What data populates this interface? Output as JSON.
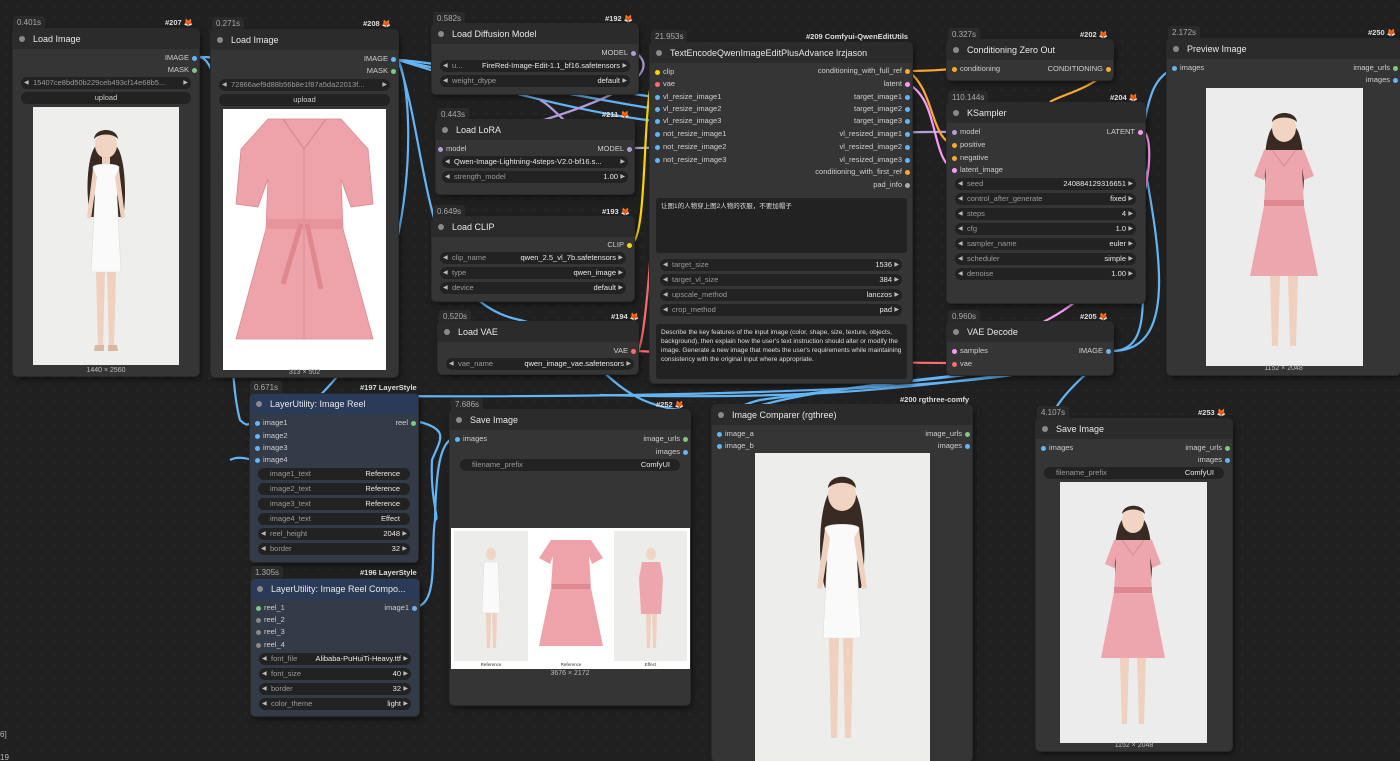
{
  "colors": {
    "image": "#64b5f6",
    "mask": "#81c784",
    "model": "#b39ddb",
    "clip": "#ffd500",
    "vae": "#ff6e6e",
    "conditioning": "#ffa931",
    "latent": "#ff9cf9",
    "string": "#7ecc7e"
  },
  "side_labels": [
    "6]",
    "19"
  ],
  "n207": {
    "time": "0.401s",
    "id": "#207",
    "title": "Load Image",
    "out1": "IMAGE",
    "out2": "MASK",
    "file": "15407ce8bd50b229ceb493cf14e68b5...",
    "upload": "upload",
    "cap": "1440 × 2560"
  },
  "n208": {
    "time": "0.271s",
    "id": "#208",
    "title": "Load Image",
    "out1": "IMAGE",
    "out2": "MASK",
    "file": "72866aef9d88b56b8e1f87a5da22013f...",
    "upload": "upload",
    "cap": "313 × 502"
  },
  "n192": {
    "time": "0.582s",
    "id": "#192",
    "title": "Load Diffusion Model",
    "out1": "MODEL",
    "w1_lbl": "u...",
    "w1_val": "FireRed-Image-Edit-1.1_bf16.safetensors",
    "w2_lbl": "weight_dtype",
    "w2_val": "default"
  },
  "n211": {
    "time": "0.443s",
    "id": "#211",
    "title": "Load LoRA",
    "in1": "model",
    "out1": "MODEL",
    "w1_val": "Qwen-Image-Lightning-4steps-V2.0-bf16.s...",
    "w2_lbl": "strength_model",
    "w2_val": "1.00"
  },
  "n193": {
    "time": "0.649s",
    "id": "#193",
    "title": "Load CLIP",
    "out1": "CLIP",
    "w1_lbl": "clip_name",
    "w1_val": "qwen_2.5_vl_7b.safetensors",
    "w2_lbl": "type",
    "w2_val": "qwen_image",
    "w3_lbl": "device",
    "w3_val": "default"
  },
  "n194": {
    "time": "0.520s",
    "id": "#194",
    "title": "Load VAE",
    "out1": "VAE",
    "w1_lbl": "vae_name",
    "w1_val": "qwen_image_vae.safetensors"
  },
  "n209": {
    "time": "21.953s",
    "id": "#209 Comfyui-QwenEditUtils",
    "title": "TextEncodeQwenImageEditPlusAdvance lrzjason",
    "inputs": [
      "clip",
      "vae",
      "vl_resize_image1",
      "vl_resize_image2",
      "vl_resize_image3",
      "not_resize_image1",
      "not_resize_image2",
      "not_resize_image3"
    ],
    "outputs": [
      "conditioning_with_full_ref",
      "latent",
      "target_image1",
      "target_image2",
      "target_image3",
      "vl_resized_image1",
      "vl_resized_image2",
      "vl_resized_image3",
      "conditioning_with_first_ref",
      "pad_info"
    ],
    "prompt": "让图1的人物穿上图2人物的衣服，不要加帽子",
    "w1_lbl": "target_size",
    "w1_val": "1536",
    "w2_lbl": "target_vl_size",
    "w2_val": "384",
    "w3_lbl": "upscale_method",
    "w3_val": "lanczos",
    "w4_lbl": "crop_method",
    "w4_val": "pad",
    "system": "Describe the key features of the input image (color, shape, size, texture, objects, background), then explain how the user's text instruction should alter or modify the image. Generate a new image that meets the user's requirements while maintaining consistency with the original input where appropriate."
  },
  "n202": {
    "time": "0.327s",
    "id": "#202",
    "title": "Conditioning Zero Out",
    "in1": "conditioning",
    "out1": "CONDITIONING"
  },
  "n204": {
    "time": "110.144s",
    "id": "#204",
    "title": "KSampler",
    "inputs": [
      "model",
      "positive",
      "negative",
      "latent_image"
    ],
    "out1": "LATENT",
    "widgets": [
      {
        "lbl": "seed",
        "val": "240884129316651"
      },
      {
        "lbl": "control_after_generate",
        "val": "fixed"
      },
      {
        "lbl": "steps",
        "val": "4"
      },
      {
        "lbl": "cfg",
        "val": "1.0"
      },
      {
        "lbl": "sampler_name",
        "val": "euler"
      },
      {
        "lbl": "scheduler",
        "val": "simple"
      },
      {
        "lbl": "denoise",
        "val": "1.00"
      }
    ]
  },
  "n205": {
    "time": "0.960s",
    "id": "#205",
    "title": "VAE Decode",
    "in1": "samples",
    "in2": "vae",
    "out1": "IMAGE"
  },
  "n250": {
    "time": "2.172s",
    "id": "#250",
    "title": "Preview Image",
    "in1": "images",
    "out1": "image_urls",
    "out2": "images",
    "cap": "1152 × 2048"
  },
  "n197": {
    "time": "0.671s",
    "id": "#197 LayerStyle",
    "title": "LayerUtility: Image Reel",
    "inputs": [
      "image1",
      "image2",
      "image3",
      "image4"
    ],
    "out1": "reel",
    "widgets": [
      {
        "lbl": "image1_text",
        "val": "Reference"
      },
      {
        "lbl": "image2_text",
        "val": "Reference"
      },
      {
        "lbl": "image3_text",
        "val": "Reference"
      },
      {
        "lbl": "image4_text",
        "val": "Effect"
      },
      {
        "lbl": "reel_height",
        "val": "2048"
      },
      {
        "lbl": "border",
        "val": "32"
      }
    ]
  },
  "n196": {
    "time": "1.305s",
    "id": "#196 LayerStyle",
    "title": "LayerUtility: Image Reel Compo...",
    "inputs": [
      "reel_1",
      "reel_2",
      "reel_3",
      "reel_4"
    ],
    "out1": "image1",
    "widgets": [
      {
        "lbl": "font_file",
        "val": "Alibaba-PuHuiTi-Heavy.ttf"
      },
      {
        "lbl": "font_size",
        "val": "40"
      },
      {
        "lbl": "border",
        "val": "32"
      },
      {
        "lbl": "color_theme",
        "val": "light"
      }
    ]
  },
  "n252": {
    "time": "7.686s",
    "id": "#252",
    "title": "Save Image",
    "in1": "images",
    "out1": "image_urls",
    "out2": "images",
    "w1_lbl": "filename_prefix",
    "w1_val": "ComfyUI",
    "cap": "3676 × 2172",
    "reel_labels": [
      "Reference",
      "Reference",
      "Effect"
    ]
  },
  "n200": {
    "id": "#200 rgthree-comfy",
    "title": "Image Comparer (rgthree)",
    "in1": "image_a",
    "in2": "image_b",
    "out1": "image_urls",
    "out2": "images"
  },
  "n253": {
    "time": "4.107s",
    "id": "#253",
    "title": "Save Image",
    "in1": "images",
    "out1": "image_urls",
    "out2": "images",
    "w1_lbl": "filename_prefix",
    "w1_val": "ComfyUI",
    "cap": "1152 × 2048"
  }
}
